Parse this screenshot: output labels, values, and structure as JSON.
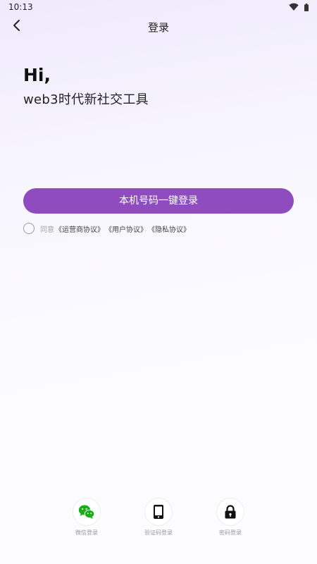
{
  "status_bar": {
    "time": "10:13"
  },
  "nav": {
    "title": "登录"
  },
  "greeting": {
    "hi": "Hi,",
    "subtitle": "web3时代新社交工具"
  },
  "onekey_login": {
    "label": "本机号码一键登录",
    "color": "#8f4cbf"
  },
  "agreement": {
    "prefix": "同意",
    "links": [
      "《运营商协议》",
      "《用户协议》",
      "《隐私协议》"
    ]
  },
  "login_options": [
    {
      "label": "微信登录",
      "icon": "wechat-icon"
    },
    {
      "label": "验证码登录",
      "icon": "phone-icon"
    },
    {
      "label": "密码登录",
      "icon": "lock-icon"
    }
  ]
}
